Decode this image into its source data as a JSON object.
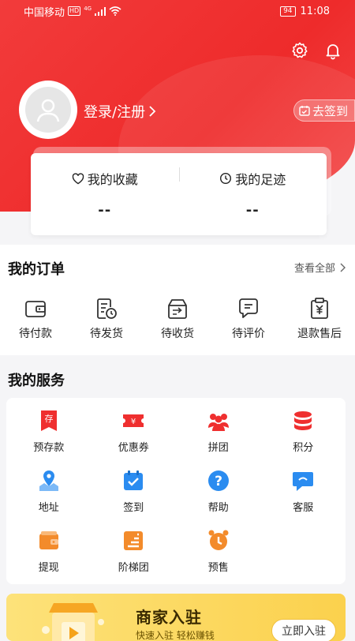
{
  "status_bar": {
    "carrier": "中国移动",
    "hd": "HD",
    "network": "4G",
    "battery": "94",
    "time": "11:08"
  },
  "header": {
    "login_label": "登录/注册",
    "signin_label": "去签到"
  },
  "favorites": {
    "collect_label": "我的收藏",
    "collect_count": "--",
    "footprint_label": "我的足迹",
    "footprint_count": "--"
  },
  "orders": {
    "title": "我的订单",
    "see_all": "查看全部",
    "items": [
      {
        "label": "待付款",
        "icon": "wallet-icon"
      },
      {
        "label": "待发货",
        "icon": "document-clock-icon"
      },
      {
        "label": "待收货",
        "icon": "delivery-box-icon"
      },
      {
        "label": "待评价",
        "icon": "comment-icon"
      },
      {
        "label": "退款售后",
        "icon": "refund-icon"
      }
    ]
  },
  "services": {
    "title": "我的服务",
    "items": [
      {
        "label": "预存款",
        "icon": "deposit-icon"
      },
      {
        "label": "优惠券",
        "icon": "coupon-icon"
      },
      {
        "label": "拼团",
        "icon": "group-icon"
      },
      {
        "label": "积分",
        "icon": "points-icon"
      },
      {
        "label": "地址",
        "icon": "map-pin-icon"
      },
      {
        "label": "签到",
        "icon": "calendar-check-icon"
      },
      {
        "label": "帮助",
        "icon": "help-icon"
      },
      {
        "label": "客服",
        "icon": "customer-service-icon"
      },
      {
        "label": "提现",
        "icon": "withdraw-icon"
      },
      {
        "label": "阶梯团",
        "icon": "tier-group-icon"
      },
      {
        "label": "预售",
        "icon": "presale-alarm-icon"
      }
    ]
  },
  "banner": {
    "title": "商家入驻",
    "subtitle": "快速入驻 轻松赚钱",
    "button": "立即入驻"
  },
  "colors": {
    "brand_red": "#ef2f2f",
    "service_blue": "#2b8cf0",
    "service_orange": "#f38b2b",
    "banner_yellow": "#fbd14d"
  }
}
